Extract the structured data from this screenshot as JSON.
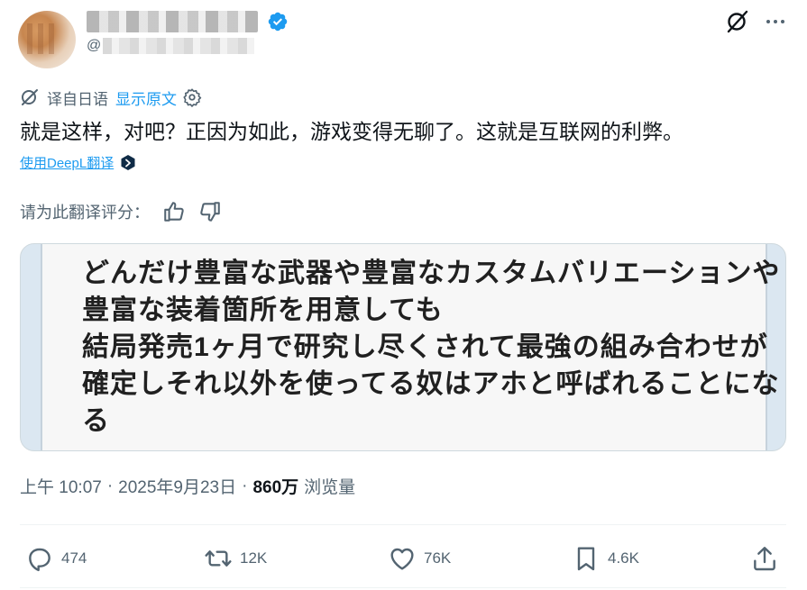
{
  "author": {
    "verified_badge_color": "#1d9bf0",
    "handle_prefix": "@"
  },
  "icons": {
    "grok": "grok-icon",
    "more": "more-horizontal-icon",
    "translate": "translate-icon",
    "settings": "gear-icon",
    "deepl": "deepl-logo-icon",
    "thumbs_up": "thumbs-up-icon",
    "thumbs_down": "thumbs-down-icon",
    "reply": "reply-icon",
    "repost": "repost-icon",
    "like": "heart-icon",
    "bookmark": "bookmark-icon",
    "share": "share-icon"
  },
  "translation": {
    "label": "译自日语",
    "show_original": "显示原文",
    "text": "就是这样，对吧？正因为如此，游戏变得无聊了。这就是互联网的利弊。",
    "provider_link": "使用DeepL翻译",
    "rate_prompt": "请为此翻译评分："
  },
  "media": {
    "lines": [
      "どんだけ豊富な武器や豊富なカスタムバリエーションや",
      "豊富な装着箇所を用意しても",
      "結局発売1ヶ月で研究し尽くされて最強の組み合わせが",
      "確定しそれ以外を使ってる奴はアホと呼ばれることにな",
      "る"
    ]
  },
  "meta": {
    "time": "上午 10:07",
    "separator": "·",
    "date": "2025年9月23日",
    "views_count": "860万",
    "views_label": "浏览量"
  },
  "actions": {
    "replies": "474",
    "reposts": "12K",
    "likes": "76K",
    "bookmarks": "4.6K"
  },
  "colors": {
    "accent": "#1d9bf0",
    "text_primary": "#0f1419",
    "text_secondary": "#536471",
    "border": "#cfd9de"
  }
}
